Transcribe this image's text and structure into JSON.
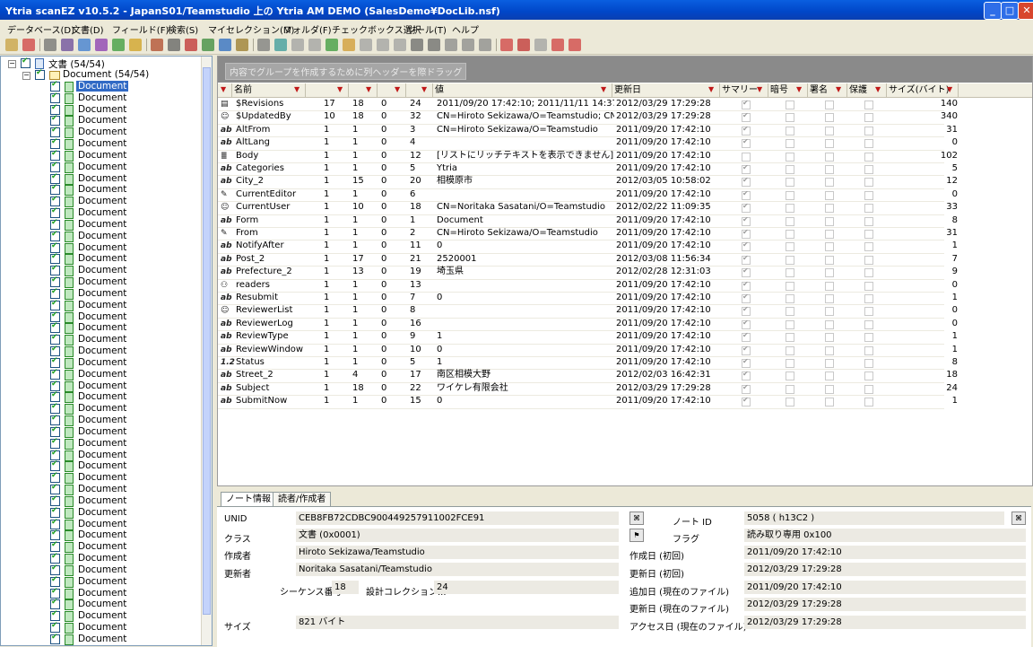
{
  "window": {
    "title": "Ytria scanEZ v10.5.2 - JapanS01/Teamstudio 上の Ytria AM DEMO (SalesDemo¥DocLib.nsf)"
  },
  "menu": [
    "データベース(D)",
    "文書(D)",
    "フィールド(F)",
    "検索(S)",
    "マイセレクション(M)",
    "フォルダ(F)",
    "チェックボックス選択",
    "ツール(T)",
    "ヘルプ"
  ],
  "tree": {
    "root_label": "文書  (54/54)",
    "folder_label": "Document  (54/54)",
    "item_label": "Document",
    "item_count": 49
  },
  "grid": {
    "group_hint": "内容でグループを作成するために列ヘッダーを際ドラッグ",
    "columns": [
      "名前",
      "",
      "",
      "",
      "",
      "値",
      "更新日",
      "サマリー",
      "暗号",
      "署名",
      "保護",
      "サイズ(バイト)"
    ],
    "rows": [
      {
        "icon": "rev",
        "name": "$Revisions",
        "c1": "17",
        "c2": "18",
        "c3": "0",
        "c4": "24",
        "value": "2011/09/20 17:42:10; 2011/11/11 14:37...",
        "date": "2012/03/29 17:29:28",
        "summary": true,
        "size": "140"
      },
      {
        "icon": "user",
        "name": "$UpdatedBy",
        "c1": "10",
        "c2": "18",
        "c3": "0",
        "c4": "32",
        "value": "CN=Hiroto Sekizawa/O=Teamstudio; CN=...",
        "date": "2012/03/29 17:29:28",
        "summary": true,
        "size": "340"
      },
      {
        "icon": "ab",
        "name": "AltFrom",
        "c1": "1",
        "c2": "1",
        "c3": "0",
        "c4": "3",
        "value": "CN=Hiroto Sekizawa/O=Teamstudio",
        "date": "2011/09/20 17:42:10",
        "summary": true,
        "size": "31"
      },
      {
        "icon": "ab",
        "name": "AltLang",
        "c1": "1",
        "c2": "1",
        "c3": "0",
        "c4": "4",
        "value": "",
        "date": "2011/09/20 17:42:10",
        "summary": true,
        "size": "0"
      },
      {
        "icon": "rt",
        "name": "Body",
        "c1": "1",
        "c2": "1",
        "c3": "0",
        "c4": "12",
        "value": "[リストにリッチテキストを表示できません] CRC: 78...",
        "date": "2011/09/20 17:42:10",
        "summary": false,
        "size": "102"
      },
      {
        "icon": "ab",
        "name": "Categories",
        "c1": "1",
        "c2": "1",
        "c3": "0",
        "c4": "5",
        "value": "Ytria",
        "date": "2011/09/20 17:42:10",
        "summary": true,
        "size": "5"
      },
      {
        "icon": "ab",
        "name": "City_2",
        "c1": "1",
        "c2": "15",
        "c3": "0",
        "c4": "20",
        "value": "相模原市",
        "date": "2012/03/05 10:58:02",
        "summary": true,
        "size": "12"
      },
      {
        "icon": "auth",
        "name": "CurrentEditor",
        "c1": "1",
        "c2": "1",
        "c3": "0",
        "c4": "6",
        "value": "",
        "date": "2011/09/20 17:42:10",
        "summary": true,
        "size": "0"
      },
      {
        "icon": "user",
        "name": "CurrentUser",
        "c1": "1",
        "c2": "10",
        "c3": "0",
        "c4": "18",
        "value": "CN=Noritaka Sasatani/O=Teamstudio",
        "date": "2012/02/22 11:09:35",
        "summary": true,
        "size": "33"
      },
      {
        "icon": "ab",
        "name": "Form",
        "c1": "1",
        "c2": "1",
        "c3": "0",
        "c4": "1",
        "value": "Document",
        "date": "2011/09/20 17:42:10",
        "summary": true,
        "size": "8"
      },
      {
        "icon": "auth",
        "name": "From",
        "c1": "1",
        "c2": "1",
        "c3": "0",
        "c4": "2",
        "value": "CN=Hiroto Sekizawa/O=Teamstudio",
        "date": "2011/09/20 17:42:10",
        "summary": true,
        "size": "31"
      },
      {
        "icon": "ab",
        "name": "NotifyAfter",
        "c1": "1",
        "c2": "1",
        "c3": "0",
        "c4": "11",
        "value": "0",
        "date": "2011/09/20 17:42:10",
        "summary": true,
        "size": "1"
      },
      {
        "icon": "ab",
        "name": "Post_2",
        "c1": "1",
        "c2": "17",
        "c3": "0",
        "c4": "21",
        "value": "2520001",
        "date": "2012/03/08 11:56:34",
        "summary": true,
        "size": "7"
      },
      {
        "icon": "ab",
        "name": "Prefecture_2",
        "c1": "1",
        "c2": "13",
        "c3": "0",
        "c4": "19",
        "value": "埼玉県",
        "date": "2012/02/28 12:31:03",
        "summary": true,
        "size": "9"
      },
      {
        "icon": "read",
        "name": "readers",
        "c1": "1",
        "c2": "1",
        "c3": "0",
        "c4": "13",
        "value": "",
        "date": "2011/09/20 17:42:10",
        "summary": true,
        "size": "0"
      },
      {
        "icon": "ab",
        "name": "Resubmit",
        "c1": "1",
        "c2": "1",
        "c3": "0",
        "c4": "7",
        "value": "0",
        "date": "2011/09/20 17:42:10",
        "summary": true,
        "size": "1"
      },
      {
        "icon": "user",
        "name": "ReviewerList",
        "c1": "1",
        "c2": "1",
        "c3": "0",
        "c4": "8",
        "value": "",
        "date": "2011/09/20 17:42:10",
        "summary": true,
        "size": "0"
      },
      {
        "icon": "ab",
        "name": "ReviewerLog",
        "c1": "1",
        "c2": "1",
        "c3": "0",
        "c4": "16",
        "value": "",
        "date": "2011/09/20 17:42:10",
        "summary": true,
        "size": "0"
      },
      {
        "icon": "ab",
        "name": "ReviewType",
        "c1": "1",
        "c2": "1",
        "c3": "0",
        "c4": "9",
        "value": "1",
        "date": "2011/09/20 17:42:10",
        "summary": true,
        "size": "1"
      },
      {
        "icon": "ab",
        "name": "ReviewWindow",
        "c1": "1",
        "c2": "1",
        "c3": "0",
        "c4": "10",
        "value": "0",
        "date": "2011/09/20 17:42:10",
        "summary": true,
        "size": "1"
      },
      {
        "icon": "num",
        "name": "Status",
        "c1": "1",
        "c2": "1",
        "c3": "0",
        "c4": "5",
        "value": "1",
        "date": "2011/09/20 17:42:10",
        "summary": true,
        "size": "8"
      },
      {
        "icon": "ab",
        "name": "Street_2",
        "c1": "1",
        "c2": "4",
        "c3": "0",
        "c4": "17",
        "value": "南区相模大野",
        "date": "2012/02/03 16:42:31",
        "summary": true,
        "size": "18"
      },
      {
        "icon": "ab",
        "name": "Subject",
        "c1": "1",
        "c2": "18",
        "c3": "0",
        "c4": "22",
        "value": "ワイケレ有限会社",
        "date": "2012/03/29 17:29:28",
        "summary": true,
        "size": "24"
      },
      {
        "icon": "ab",
        "name": "SubmitNow",
        "c1": "1",
        "c2": "1",
        "c3": "0",
        "c4": "15",
        "value": "0",
        "date": "2011/09/20 17:42:10",
        "summary": true,
        "size": "1"
      }
    ]
  },
  "icon_glyphs": {
    "ab": "ab",
    "num": "1.2",
    "rt": "≣",
    "user": "☺",
    "auth": "✎",
    "rev": "▤",
    "read": "⚇"
  },
  "details": {
    "tabs": [
      "ノート情報",
      "読者/作成者"
    ],
    "unid_label": "UNID",
    "unid": "CEB8FB72CDBC900449257911002FCE91",
    "class_label": "クラス",
    "class": "文書 (0x0001)",
    "author_label": "作成者",
    "author": "Hiroto Sekizawa/Teamstudio",
    "updater_label": "更新者",
    "updater": "Noritaka Sasatani/Teamstudio",
    "seq_label": "シーケンス番号",
    "seq": "18",
    "design_label": "設計コレクション...",
    "design": "24",
    "size_label": "サイズ",
    "size": "821 バイト",
    "noteid_label": "ノート ID",
    "noteid": "5058 ( h13C2 )",
    "flag_label": "フラグ",
    "flag": "読み取り専用 0x100",
    "created_label": "作成日 (初回)",
    "created": "2011/09/20 17:42:10",
    "modified_label": "更新日 (初回)",
    "modified": "2012/03/29 17:29:28",
    "added_label": "追加日 (現在のファイル)",
    "added": "2011/09/20 17:42:10",
    "modfile_label": "更新日 (現在のファイル)",
    "modfile": "2012/03/29 17:29:28",
    "access_label": "アクセス日 (現在のファイル)",
    "access": "2012/03/29 17:29:28"
  }
}
